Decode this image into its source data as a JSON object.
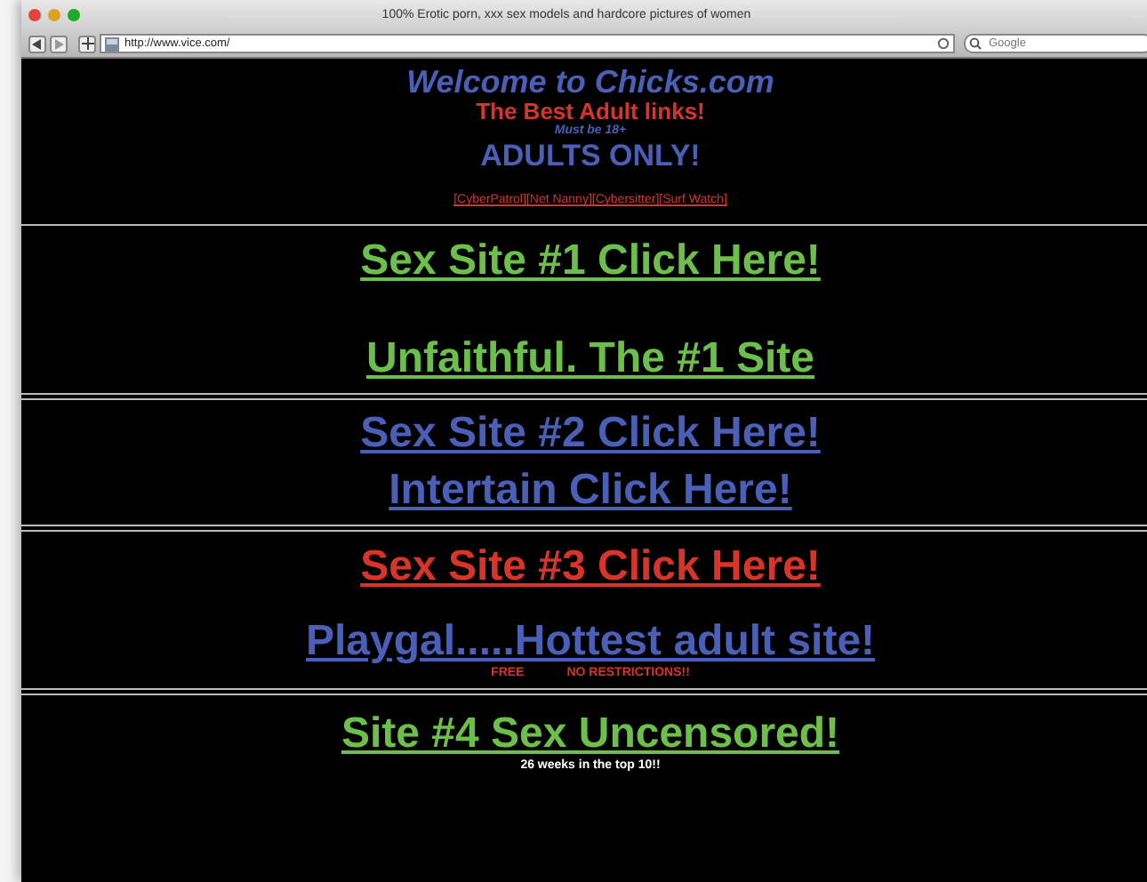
{
  "window": {
    "title": "100% Erotic porn, xxx sex models and hardcore pictures of women",
    "url": "http://www.vice.com/",
    "search_placeholder": "Google"
  },
  "header": {
    "welcome": "Welcome to Chicks.com",
    "tagline": "The Best Adult links!",
    "age_note": "Must be 18+",
    "adults": "ADULTS ONLY!",
    "filters": [
      "[CyberPatrol]",
      "[Net Nanny]",
      "[Cybersitter]",
      "[Surf Watch]"
    ]
  },
  "sections": [
    {
      "items": [
        {
          "kind": "link",
          "text": "Sex Site #1 Click Here!",
          "color": "#6cc04a"
        },
        {
          "kind": "link",
          "text": "Unfaithful. The #1 Site",
          "color": "#6cc04a"
        }
      ]
    },
    {
      "items": [
        {
          "kind": "link",
          "text": "Sex Site #2 Click Here!",
          "color": "#4a5fb8"
        },
        {
          "kind": "link",
          "text": "Intertain Click Here!",
          "color": "#4a5fb8"
        }
      ]
    },
    {
      "items": [
        {
          "kind": "link",
          "text": "Sex Site #3 Click Here!",
          "color": "#d8342a"
        },
        {
          "kind": "link",
          "text": "Playgal.....Hottest adult site!",
          "color": "#4a5fb8"
        },
        {
          "kind": "notes",
          "texts": [
            "FREE",
            "NO RESTRICTIONS!!"
          ],
          "color": "#d8342a"
        }
      ]
    },
    {
      "items": [
        {
          "kind": "link",
          "text": "Site #4 Sex Uncensored!",
          "color": "#6cc04a"
        },
        {
          "kind": "notes",
          "texts": [
            "26 weeks in the top 10!!"
          ],
          "color": "#ffffff"
        }
      ]
    }
  ]
}
